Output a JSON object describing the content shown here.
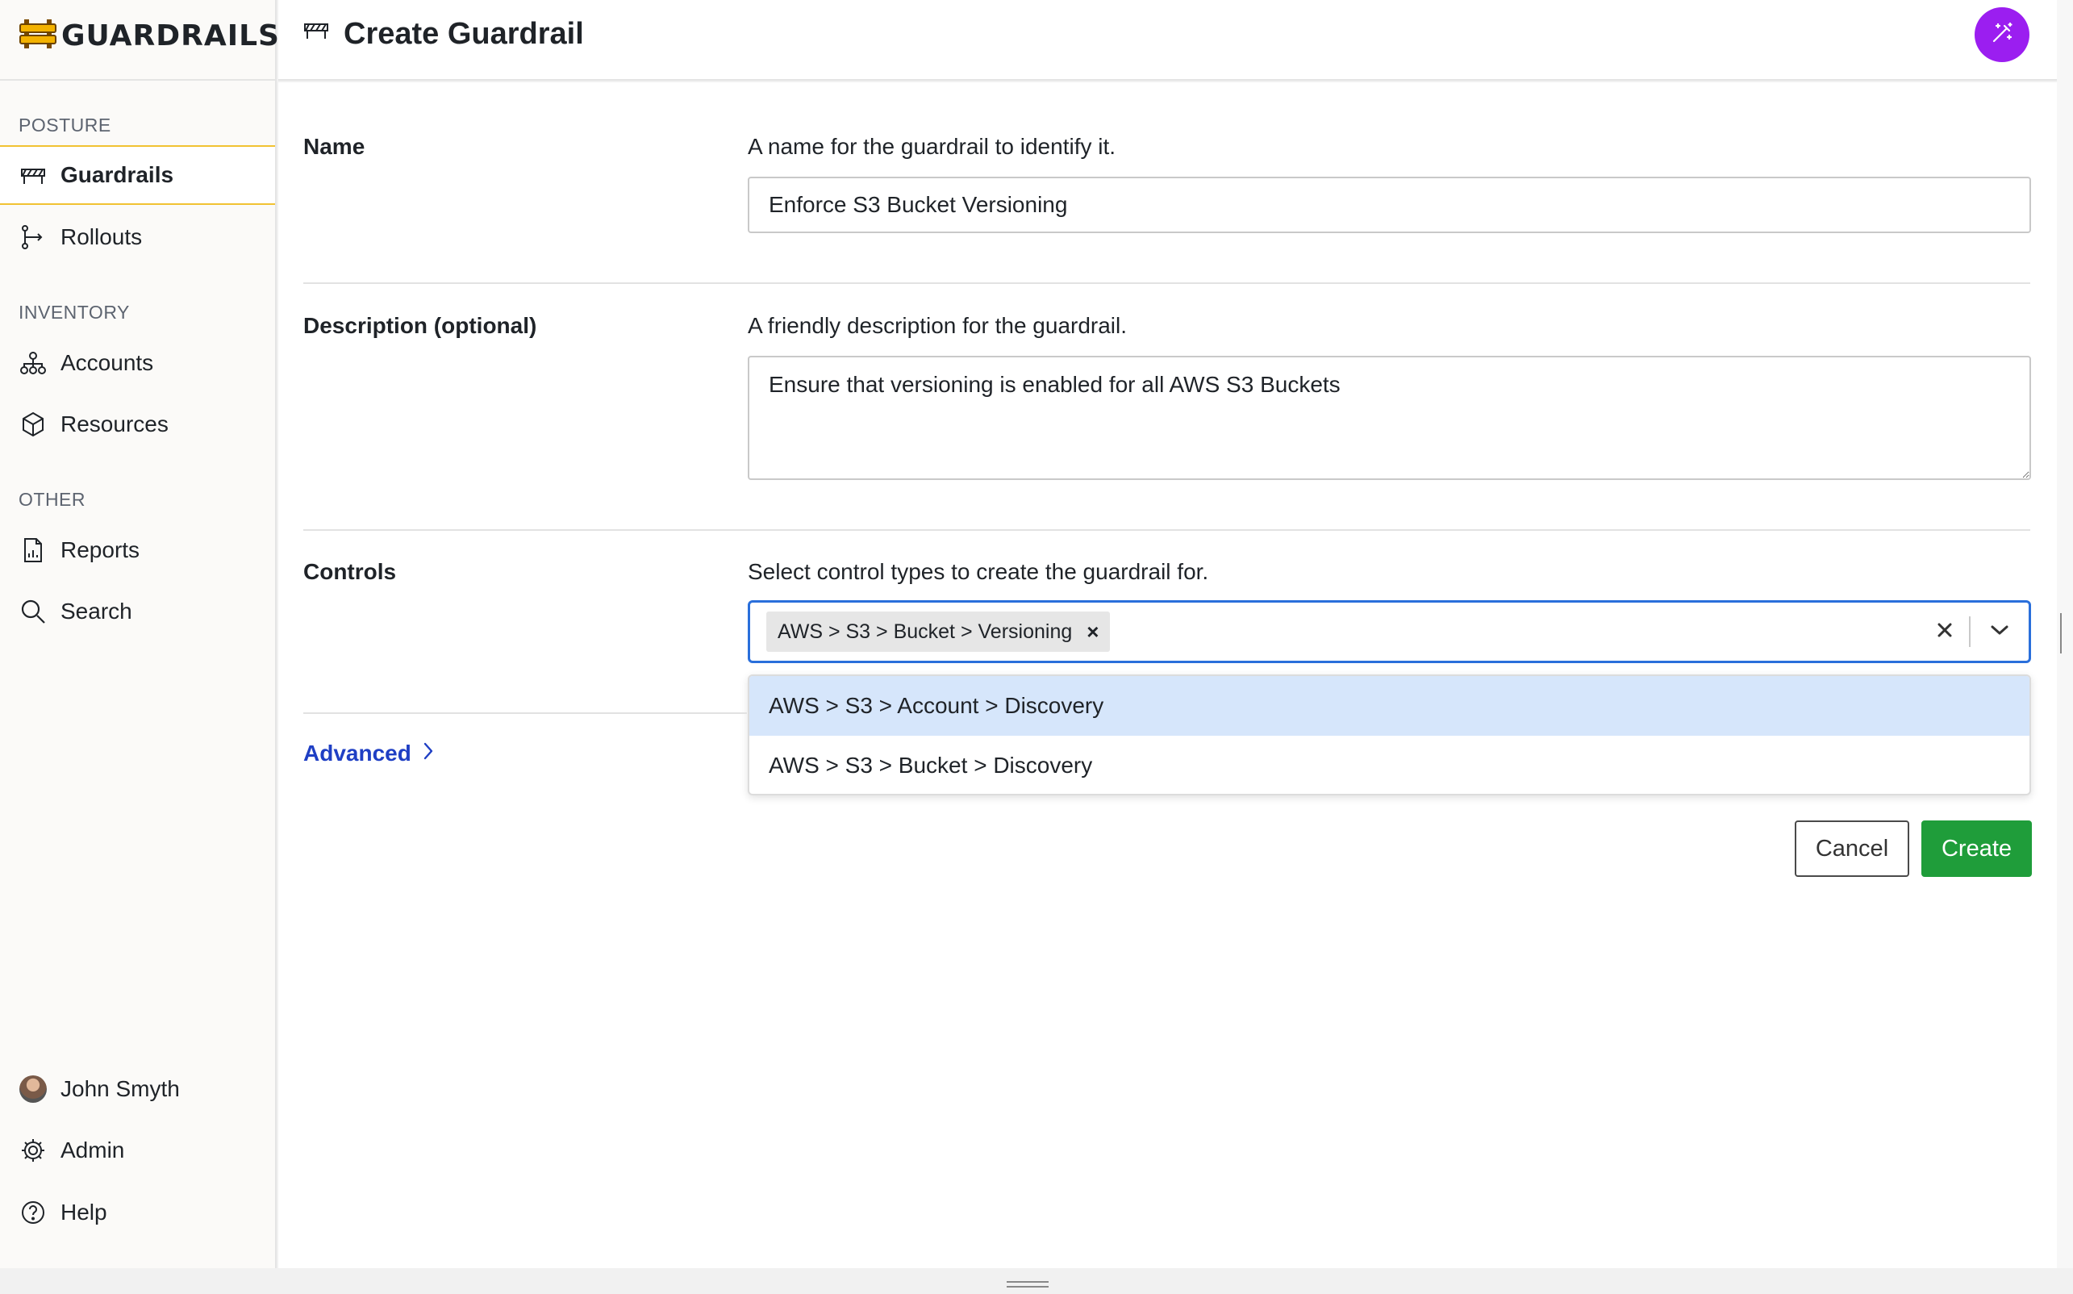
{
  "app": {
    "brand": "GUARDRAILS"
  },
  "header": {
    "title": "Create Guardrail"
  },
  "sidebar": {
    "sections": [
      {
        "label": "POSTURE",
        "items": [
          {
            "label": "Guardrails",
            "icon": "barrier-icon",
            "active": true
          },
          {
            "label": "Rollouts",
            "icon": "rollout-icon"
          }
        ]
      },
      {
        "label": "INVENTORY",
        "items": [
          {
            "label": "Accounts",
            "icon": "hierarchy-icon"
          },
          {
            "label": "Resources",
            "icon": "cube-icon"
          }
        ]
      },
      {
        "label": "OTHER",
        "items": [
          {
            "label": "Reports",
            "icon": "report-icon"
          },
          {
            "label": "Search",
            "icon": "search-icon"
          }
        ]
      }
    ],
    "footer": [
      {
        "label": "John Smyth",
        "icon": "avatar"
      },
      {
        "label": "Admin",
        "icon": "gear-icon"
      },
      {
        "label": "Help",
        "icon": "help-icon"
      }
    ]
  },
  "form": {
    "name": {
      "label": "Name",
      "help": "A name for the guardrail to identify it.",
      "value": "Enforce S3 Bucket Versioning"
    },
    "description": {
      "label": "Description (optional)",
      "help": "A friendly description for the guardrail.",
      "value": "Ensure that versioning is enabled for all AWS S3 Buckets"
    },
    "controls": {
      "label": "Controls",
      "help": "Select control types to create the guardrail for.",
      "selected": [
        "AWS > S3 > Bucket > Versioning"
      ],
      "options": [
        "AWS > S3 > Account > Discovery",
        "AWS > S3 > Bucket > Discovery"
      ],
      "highlighted_option": "AWS > S3 > Account > Discovery"
    },
    "advanced_label": "Advanced",
    "cancel_label": "Cancel",
    "create_label": "Create"
  },
  "colors": {
    "accent_yellow": "#f1c232",
    "magic_purple": "#9b1ef0",
    "create_green": "#1f9d3a",
    "link_blue": "#1f3fc4",
    "focus_blue": "#2a6fdb",
    "option_highlight": "#d6e6fb"
  }
}
